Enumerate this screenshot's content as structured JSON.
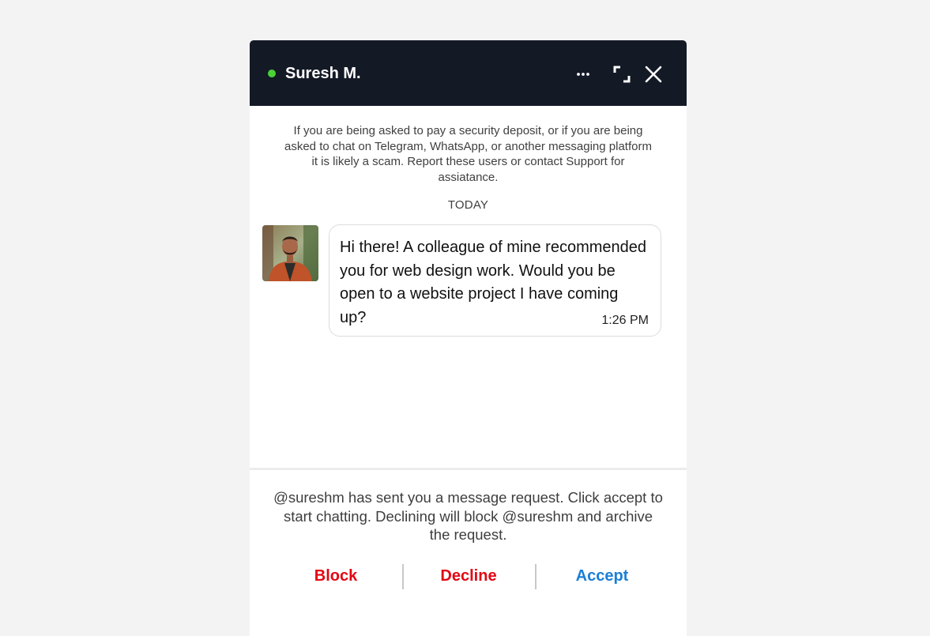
{
  "header": {
    "contact_name": "Suresh M.",
    "status_color": "#4cd137",
    "background_color": "#141926",
    "icons": [
      "more-options-icon",
      "expand-icon",
      "close-icon"
    ]
  },
  "notice": {
    "text": "If you are being asked to pay a security deposit, or if you are being asked to chat on Telegram, WhatsApp, or another messaging platform it is likely a scam. Report these users or contact Support for assiatance."
  },
  "conversation": {
    "day_label": "TODAY",
    "messages": [
      {
        "sender": "Suresh M.",
        "text": "Hi there! A colleague of mine recommended you for web design work. Would you be open to a website project I have coming up?",
        "time": "1:26 PM"
      }
    ]
  },
  "request": {
    "text": "@sureshm has sent you a message request. Click accept to start chatting. Declining will block @sureshm and archive the request."
  },
  "actions": {
    "block_label": "Block",
    "decline_label": "Decline",
    "accept_label": "Accept",
    "block_color": "#e30613",
    "decline_color": "#e30613",
    "accept_color": "#1a7fd6"
  }
}
